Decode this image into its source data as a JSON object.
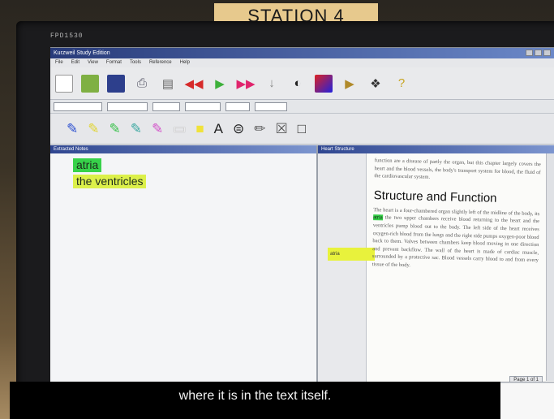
{
  "scene": {
    "station_sign": "STATION 4",
    "monitor_model": "FPD1530"
  },
  "app": {
    "window_title": "Kurzweil Study Edition",
    "menu": [
      "File",
      "Edit",
      "View",
      "Format",
      "Tools",
      "Reference",
      "Help"
    ]
  },
  "left_pane": {
    "title": "Extracted Notes",
    "words": [
      "atria",
      "the ventricles"
    ]
  },
  "right_pane": {
    "title": "Heart Structure",
    "intro_text": "function are a disease of partly the organ, but this chapter largely covers the heart and the blood vessels, the body's transport system for blood, the fluid of the cardiovascular system.",
    "heading": "Structure and Function",
    "body_before_mark": "The heart is a four-chambered organ slightly left of the midline of the body, its",
    "mark": "atria",
    "body_after_mark": "the two upper chambers receive blood returning to the heart and the ventricles pump blood out to the body. The left side of the heart receives oxygen-rich blood from the lungs and the right side pumps oxygen-poor blood back to them. Valves between chambers keep blood moving in one direction and prevent backflow. The wall of the heart is made of cardiac muscle, surrounded by a protective sac. Blood vessels carry blood to and from every tissue of the body.",
    "margin_note": "atria",
    "page_label": "Page 1 of 1"
  },
  "subtitle": "where it is in the text itself."
}
